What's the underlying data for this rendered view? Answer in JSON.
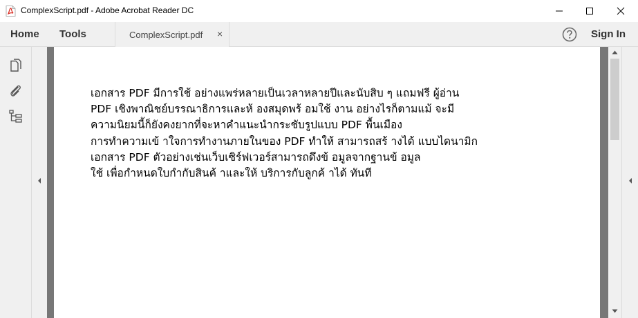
{
  "window": {
    "title": "ComplexScript.pdf - Adobe Acrobat Reader DC",
    "icons": {
      "app": "pdf-file-icon",
      "minimize": "minimize-icon",
      "maximize": "maximize-icon",
      "close": "close-icon"
    }
  },
  "toolbar": {
    "home_label": "Home",
    "tools_label": "Tools",
    "tab_label": "ComplexScript.pdf",
    "tab_close": "×",
    "help_icon": "question-circle-icon",
    "sign_in_label": "Sign In"
  },
  "left_panel": {
    "tools": [
      {
        "name": "page-thumbnails",
        "icon": "copy-pages-icon"
      },
      {
        "name": "attachments",
        "icon": "paperclip-icon"
      },
      {
        "name": "bookmarks",
        "icon": "bookmark-tree-icon"
      }
    ]
  },
  "document": {
    "lines": [
      "เอกสาร PDF มีการใช้ อย่างแพร่หลายเป็นเวลาหลายปีและนับสิบ ๆ แถมฟรี ผู้อ่าน",
      "PDF เชิงพาณิชย์บรรณาธิการและห้ องสมุดพร้ อมใช้ งาน อย่างไรก็ตามแม้ จะมี",
      "ความนิยมนี้ก็ยังคงยากที่จะหาคำแนะนำกระชับรูปแบบ PDF พื้นเมือง",
      "การทำความเข้ าใจการทำงานภายในของ PDF ทำให้ สามารถสร้ างได้ แบบไดนามิก",
      "เอกสาร PDF ตัวอย่างเช่นเว็บเซิร์ฟเวอร์สามารถดึงข้ อมูลจากฐานข้ อมูล",
      "ใช้ เพื่อกำหนดใบกำกับสินค้ าและให้ บริการกับลูกค้ าได้ ทันที"
    ]
  },
  "scrollbar": {
    "position": 0.0
  },
  "colors": {
    "chrome_bg": "#f0f0f0",
    "doc_bg": "#777777",
    "page_bg": "#ffffff",
    "pdf_red": "#d9261c"
  }
}
